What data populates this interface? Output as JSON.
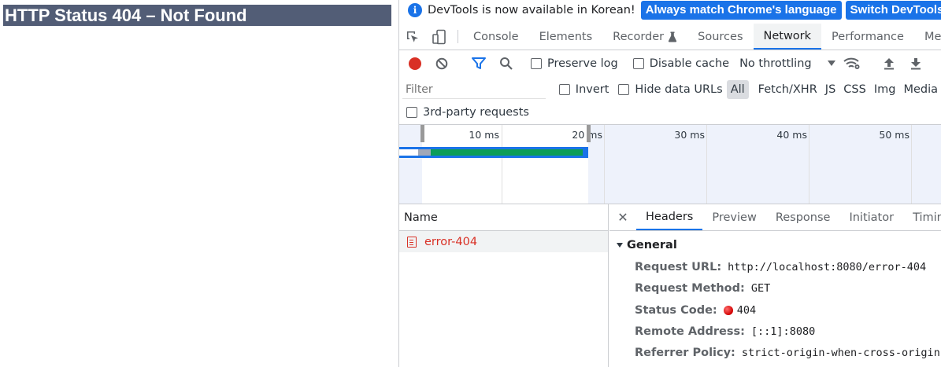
{
  "page": {
    "heading": "HTTP Status 404 – Not Found"
  },
  "infobar": {
    "icon": "info-icon",
    "message": "DevTools is now available in Korean!",
    "btn_match": "Always match Chrome's language",
    "btn_switch": "Switch DevTools to Korean"
  },
  "tabs": [
    {
      "label": "Console"
    },
    {
      "label": "Elements"
    },
    {
      "label": "Recorder"
    },
    {
      "label": "Sources"
    },
    {
      "label": "Network"
    },
    {
      "label": "Performance"
    },
    {
      "label": "Memory"
    }
  ],
  "toolbar": {
    "preserve_log": "Preserve log",
    "disable_cache": "Disable cache",
    "throttling": "No throttling"
  },
  "filter": {
    "placeholder": "Filter",
    "invert": "Invert",
    "hide_data_urls": "Hide data URLs",
    "types": [
      "All",
      "Fetch/XHR",
      "JS",
      "CSS",
      "Img",
      "Media"
    ],
    "third_party": "3rd-party requests"
  },
  "overview": {
    "ticks": [
      "10 ms",
      "20 ms",
      "30 ms",
      "40 ms",
      "50 ms"
    ]
  },
  "requests": {
    "column_name": "Name",
    "rows": [
      {
        "name": "error-404",
        "status_color": "#d93025"
      }
    ]
  },
  "details": {
    "tabs": [
      "Headers",
      "Preview",
      "Response",
      "Initiator",
      "Timing"
    ],
    "section": "General",
    "request_url_label": "Request URL:",
    "request_url": "http://localhost:8080/error-404",
    "request_method_label": "Request Method:",
    "request_method": "GET",
    "status_code_label": "Status Code:",
    "status_code": "404",
    "remote_address_label": "Remote Address:",
    "remote_address": "[::1]:8080",
    "referrer_policy_label": "Referrer Policy:",
    "referrer_policy": "strict-origin-when-cross-origin"
  },
  "colors": {
    "accent": "#1a73e8",
    "error": "#d93025",
    "heading_bg": "#525d76"
  }
}
